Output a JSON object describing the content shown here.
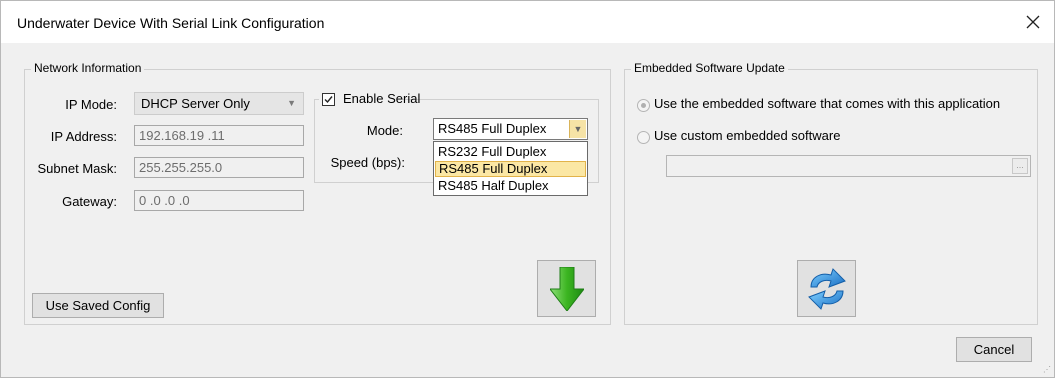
{
  "window": {
    "title": "Underwater Device With Serial Link Configuration"
  },
  "network": {
    "legend": "Network Information",
    "ip_mode_label": "IP Mode:",
    "ip_mode_value": "DHCP Server Only",
    "ip_address_label": "IP Address:",
    "ip_address_value": "192.168.19 .11",
    "subnet_label": "Subnet Mask:",
    "subnet_value": "255.255.255.0",
    "gateway_label": "Gateway:",
    "gateway_value": "0  .0  .0  .0",
    "use_saved_label": "Use Saved Config"
  },
  "serial": {
    "enable_label": "Enable Serial",
    "enabled": true,
    "mode_label": "Mode:",
    "mode_value": "RS485 Full Duplex",
    "speed_label": "Speed (bps):",
    "options": [
      "RS232 Full Duplex",
      "RS485 Full Duplex",
      "RS485 Half Duplex"
    ],
    "selected_option": "RS485 Full Duplex"
  },
  "embedded": {
    "legend": "Embedded Software Update",
    "option_embedded": "Use the embedded software that comes with this application",
    "option_custom": "Use custom embedded software",
    "selected": "option_embedded",
    "path_value": "",
    "browse_label": "..."
  },
  "footer": {
    "cancel_label": "Cancel"
  },
  "icons": {
    "close": "close-icon",
    "download": "green-down-arrow-icon",
    "update": "blue-refresh-icon",
    "check": "checkmark-icon"
  },
  "colors": {
    "download_arrow": "#3cb521",
    "update_arrows": "#2a8fd8",
    "selected_option_bg": "#fbe7a4"
  }
}
